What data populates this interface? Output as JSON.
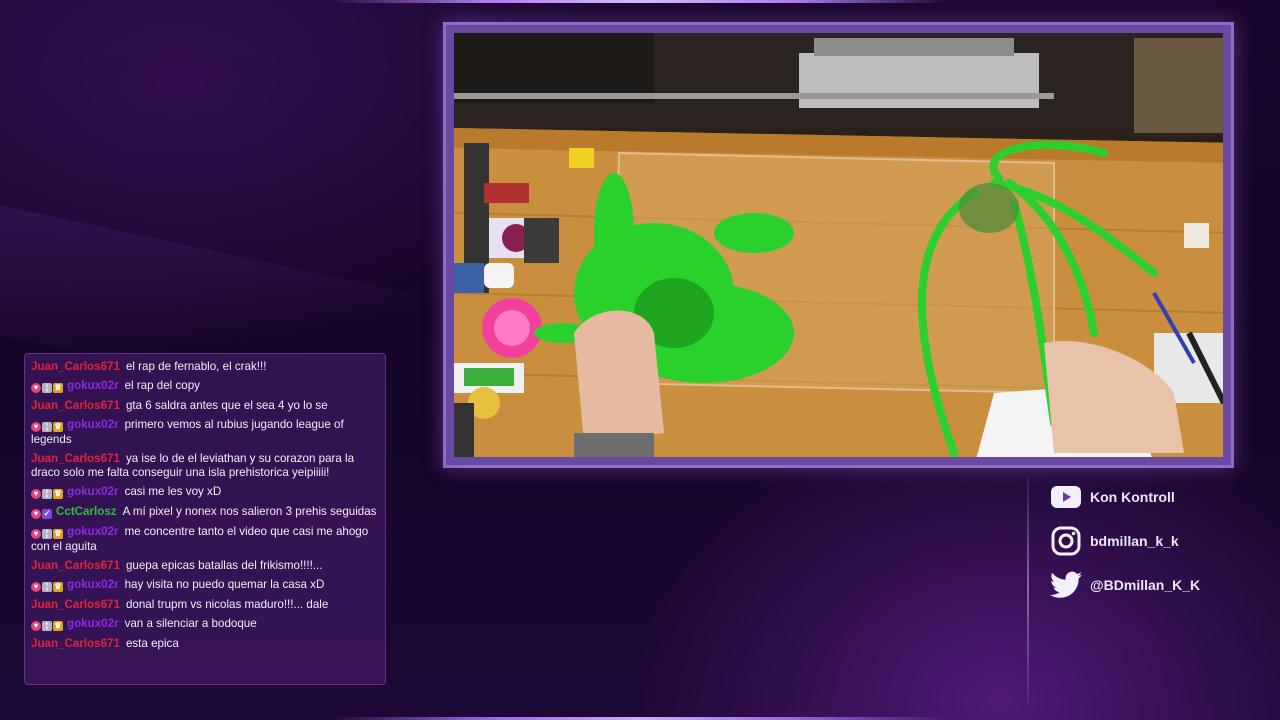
{
  "chat": {
    "messages": [
      {
        "user": "Juan_Carlos671",
        "color": "#e0233a",
        "badges": [],
        "text": "el rap de fernablo, el crak!!!"
      },
      {
        "user": "gokux02r",
        "color": "#8a2be2",
        "badges": [
          "heart",
          "gift",
          "crown"
        ],
        "text": "el rap del copy"
      },
      {
        "user": "Juan_Carlos671",
        "color": "#e0233a",
        "badges": [],
        "text": "gta 6 saldra antes que el sea 4 yo lo se"
      },
      {
        "user": "gokux02r",
        "color": "#8a2be2",
        "badges": [
          "heart",
          "gift",
          "crown"
        ],
        "text": "primero vemos al rubius jugando league of legends"
      },
      {
        "user": "Juan_Carlos671",
        "color": "#e0233a",
        "badges": [],
        "text": "ya ise lo de el leviathan y su corazon para la draco solo me falta conseguir una isla prehistorica yeipiiiii!"
      },
      {
        "user": "gokux02r",
        "color": "#8a2be2",
        "badges": [
          "heart",
          "gift",
          "crown"
        ],
        "text": "casi me les voy xD"
      },
      {
        "user": "CctCarlosz",
        "color": "#2fbf3a",
        "badges": [
          "heart",
          "sub"
        ],
        "text": "A mí pixel y nonex nos salieron 3 prehis seguidas"
      },
      {
        "user": "gokux02r",
        "color": "#8a2be2",
        "badges": [
          "heart",
          "gift",
          "crown"
        ],
        "text": "me concentre tanto el video que casi me ahogo con el aguita"
      },
      {
        "user": "Juan_Carlos671",
        "color": "#e0233a",
        "badges": [],
        "text": "guepa epicas batallas del frikismo!!!!..."
      },
      {
        "user": "gokux02r",
        "color": "#8a2be2",
        "badges": [
          "heart",
          "gift",
          "crown"
        ],
        "text": "hay visita no puedo quemar la casa xD"
      },
      {
        "user": "Juan_Carlos671",
        "color": "#e0233a",
        "badges": [],
        "text": "donal trupm vs nicolas maduro!!!... dale"
      },
      {
        "user": "gokux02r",
        "color": "#8a2be2",
        "badges": [
          "heart",
          "gift",
          "crown"
        ],
        "text": "van a silenciar a bodoque"
      },
      {
        "user": "Juan_Carlos671",
        "color": "#e0233a",
        "badges": [],
        "text": "esta epica"
      }
    ]
  },
  "socials": {
    "youtube": {
      "label": "Kon Kontroll",
      "icon": "youtube-icon"
    },
    "instagram": {
      "label": "bdmillan_k_k",
      "icon": "instagram-icon"
    },
    "twitter": {
      "label": "@BDmillan_K_K",
      "icon": "twitter-icon"
    }
  },
  "colors": {
    "frame_border": "#8e6bc4",
    "accent": "#b07af0",
    "background": "#160628"
  }
}
